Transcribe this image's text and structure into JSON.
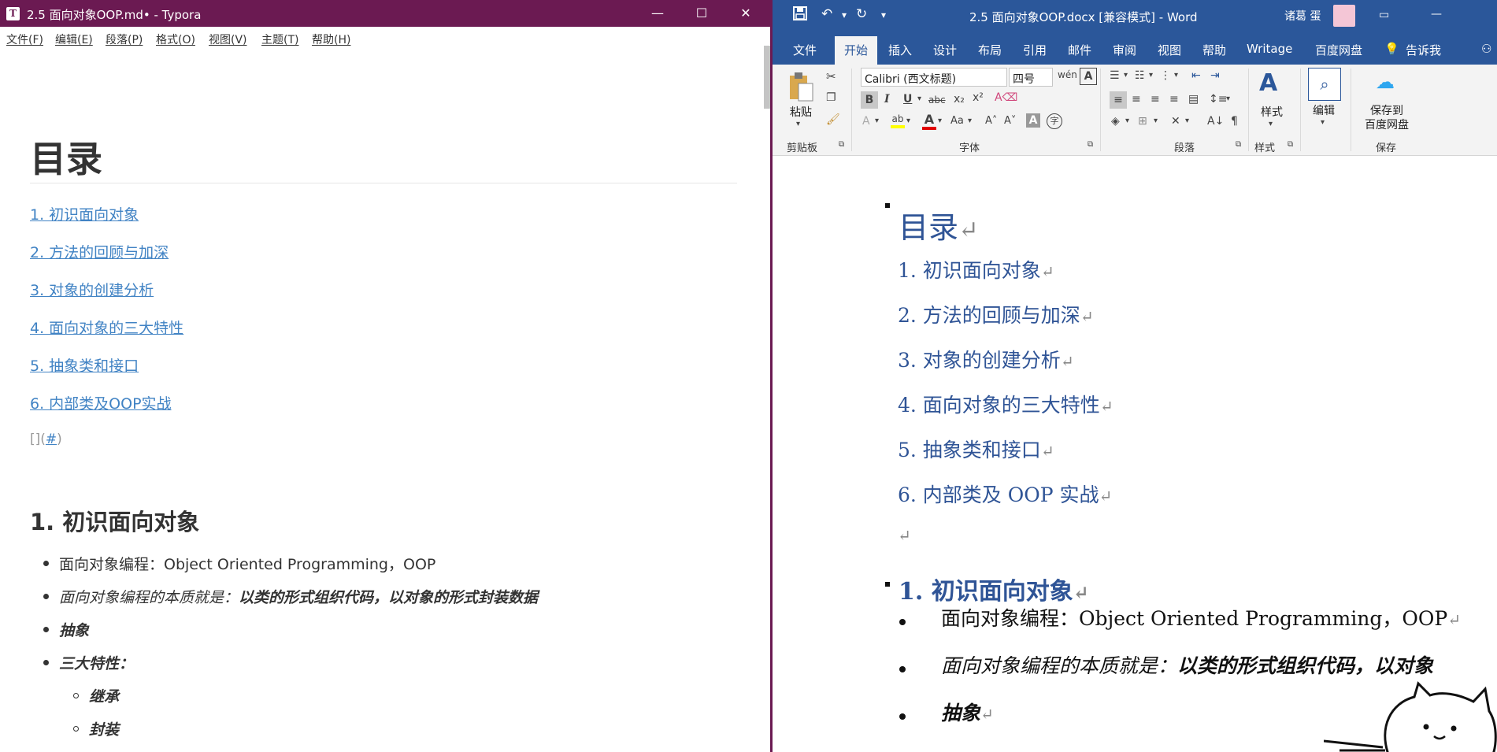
{
  "typora": {
    "title": "2.5 面向对象OOP.md• - Typora",
    "app_icon": "T",
    "window_buttons": [
      "—",
      "☐",
      "✕"
    ],
    "menu": [
      "文件(F)",
      "编辑(E)",
      "段落(P)",
      "格式(O)",
      "视图(V)",
      "主题(T)",
      "帮助(H)"
    ],
    "h1": "目录",
    "toc": [
      "1. 初识面向对象",
      "2. 方法的回顾与加深",
      "3. 对象的创建分析",
      "4. 面向对象的三大特性",
      "5. 抽象类和接口",
      "6. 内部类及OOP实战"
    ],
    "anchor_prefix": "[](",
    "anchor_link": "#",
    "anchor_suffix": ")",
    "h2": "1. 初识面向对象",
    "bullet1": "面向对象编程：Object Oriented Programming，OOP",
    "bullet2_plain": "面向对象编程的本质就是：",
    "bullet2_bold": "以类的形式组织代码，以对象的形式封装数据",
    "bullet3": "抽象",
    "bullet4": "三大特性：",
    "sub1": "继承",
    "sub2": "封装"
  },
  "word": {
    "title": "2.5 面向对象OOP.docx [兼容模式]  -  Word",
    "user": "诸葛 蛋",
    "qat": [
      "save-icon",
      "undo-icon",
      "redo-icon",
      "customize-icon"
    ],
    "tabs": [
      "文件",
      "开始",
      "插入",
      "设计",
      "布局",
      "引用",
      "邮件",
      "审阅",
      "视图",
      "帮助",
      "Writage",
      "百度网盘",
      "告诉我"
    ],
    "active_tab": "开始",
    "font_name": "Calibri (西文标题)",
    "font_size": "四号",
    "groups": [
      "剪贴板",
      "字体",
      "段落",
      "样式",
      "保存"
    ],
    "paste": "粘贴",
    "styles": "样式",
    "edit": "编辑",
    "save_to": "保存到",
    "baidu": "百度网盘",
    "h1": "目录",
    "toc": [
      "1. 初识面向对象",
      "2. 方法的回顾与加深",
      "3. 对象的创建分析",
      "4. 面向对象的三大特性",
      "5. 抽象类和接口",
      "6. 内部类及 OOP 实战"
    ],
    "return_mark": "↵",
    "h2": "1. 初识面向对象",
    "bullet1": "面向对象编程：Object Oriented Programming，OOP",
    "bullet2_plain": "面向对象编程的本质就是：",
    "bullet2_bold": "以类的形式组织代码，以对象",
    "bullet3": "抽象",
    "colors": {
      "title_bar": "#2b579a",
      "heading": "#2f5496",
      "font_color_red": "#e00000",
      "highlight": "#ffff00"
    }
  }
}
